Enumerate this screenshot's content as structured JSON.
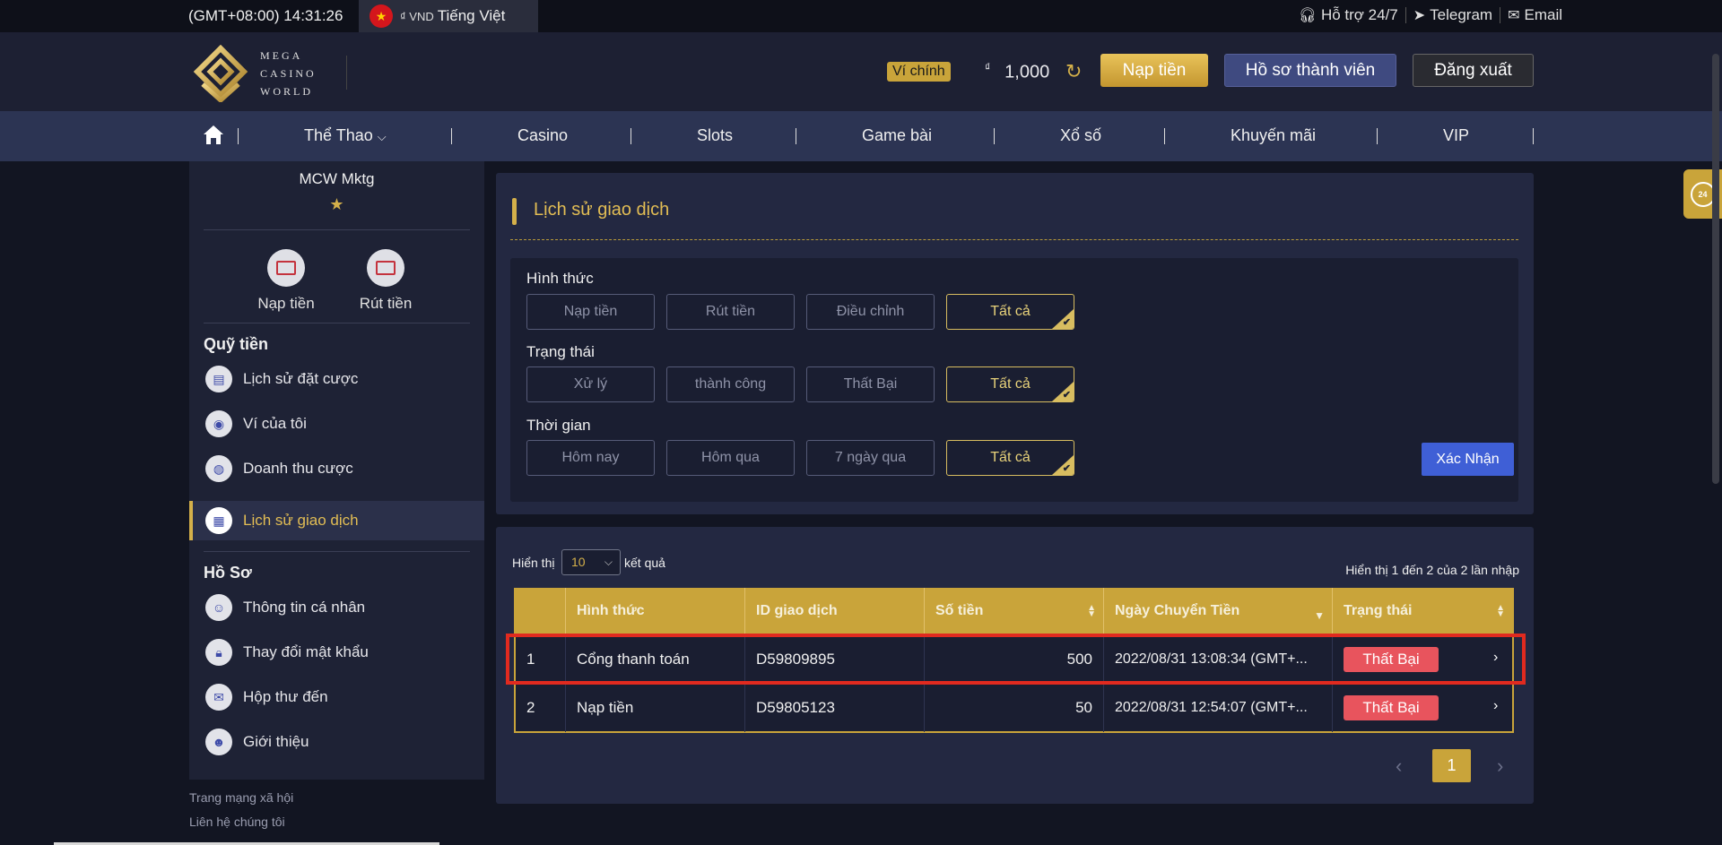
{
  "topbar": {
    "time": "(GMT+08:00) 14:31:26",
    "currency": "₫ VND",
    "language": "Tiếng Việt",
    "support": "Hỗ trợ 24/7",
    "telegram": "Telegram",
    "email": "Email"
  },
  "header": {
    "logo_lines": [
      "MEGA",
      "CASINO",
      "WORLD"
    ],
    "wallet_label": "Ví chính",
    "currency_symbol": "₫",
    "balance": "1,000",
    "deposit_button": "Nạp tiền",
    "profile_button": "Hồ sơ thành viên",
    "logout_button": "Đăng xuất"
  },
  "nav": {
    "items": [
      "Thể Thao",
      "Casino",
      "Slots",
      "Game bài",
      "Xổ số",
      "Khuyến mãi",
      "VIP"
    ]
  },
  "sidebar": {
    "username": "MCW Mktg",
    "quick_actions": [
      "Nạp tiền",
      "Rút tiền"
    ],
    "section_funds": "Quỹ tiền",
    "fund_items": [
      "Lịch sử đặt cược",
      "Ví của tôi",
      "Doanh thu cược",
      "Lịch sử giao dịch"
    ],
    "section_profile": "Hồ Sơ",
    "profile_items": [
      "Thông tin cá nhân",
      "Thay đổi mật khẩu",
      "Hộp thư đến",
      "Giới thiệu"
    ],
    "footer_links": [
      "Trang mạng xã hội",
      "Liên hệ chúng tôi"
    ]
  },
  "filters": {
    "title": "Lịch sử giao dịch",
    "type_label": "Hình thức",
    "type_options": [
      "Nạp tiền",
      "Rút tiền",
      "Điều chỉnh",
      "Tất cả"
    ],
    "status_label": "Trạng thái",
    "status_options": [
      "Xử lý",
      "thành công",
      "Thất Bại",
      "Tất cả"
    ],
    "time_label": "Thời gian",
    "time_options": [
      "Hôm nay",
      "Hôm qua",
      "7 ngày qua",
      "Tất cả"
    ],
    "confirm_button": "Xác Nhận"
  },
  "table": {
    "show_label": "Hiển thị",
    "page_size": "10",
    "results_label": "kết quả",
    "info": "Hiển thị 1 đến 2 của 2 lần nhập",
    "columns": [
      "Hình thức",
      "ID giao dịch",
      "Số tiền",
      "Ngày Chuyển Tiền",
      "Trạng thái"
    ],
    "rows": [
      {
        "no": "1",
        "type": "Cổng thanh toán",
        "id": "D59809895",
        "amount": "500",
        "date": "2022/08/31 13:08:34 (GMT+...",
        "status": "Thất Bại"
      },
      {
        "no": "2",
        "type": "Nạp tiền",
        "id": "D59805123",
        "amount": "50",
        "date": "2022/08/31 12:54:07 (GMT+...",
        "status": "Thất Bại"
      }
    ],
    "current_page": "1"
  },
  "colors": {
    "accent_gold": "#c9a43a",
    "failed_badge": "#e8545d",
    "confirm_blue": "#3f5fd6",
    "highlight_red": "#e12a1f"
  }
}
